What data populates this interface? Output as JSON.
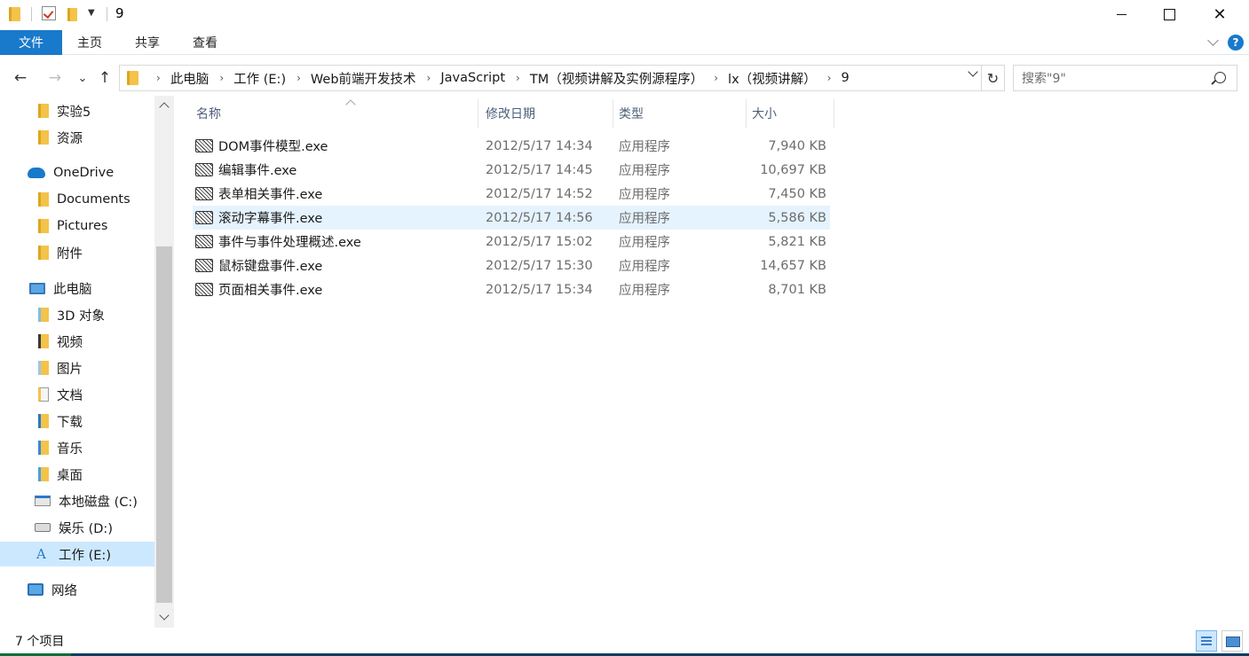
{
  "window": {
    "title": "9",
    "minimize": "",
    "maximize": "",
    "close": "✕"
  },
  "ribbon": {
    "tabs": [
      {
        "label": "文件"
      },
      {
        "label": "主页"
      },
      {
        "label": "共享"
      },
      {
        "label": "查看"
      }
    ],
    "help": "?"
  },
  "nav": {
    "back": "←",
    "forward": "→",
    "recent": "⌄",
    "up": "↑",
    "breadcrumbs": [
      "此电脑",
      "工作 (E:)",
      "Web前端开发技术",
      "JavaScript",
      "TM（视频讲解及实例源程序）",
      "lx（视频讲解）",
      "9"
    ],
    "separator": "›",
    "refresh": "↻",
    "search_placeholder": "搜索\"9\""
  },
  "sidebar": {
    "items": [
      {
        "label": "实验5",
        "icon": "folder-icon"
      },
      {
        "label": "资源",
        "icon": "folder-icon"
      },
      {
        "label": "OneDrive",
        "icon": "onedrive-icon"
      },
      {
        "label": "Documents",
        "icon": "folder-icon"
      },
      {
        "label": "Pictures",
        "icon": "folder-icon"
      },
      {
        "label": "附件",
        "icon": "folder-icon"
      },
      {
        "label": "此电脑",
        "icon": "this-pc-icon"
      },
      {
        "label": "3D 对象",
        "icon": "3d-objects-icon"
      },
      {
        "label": "视频",
        "icon": "videos-icon"
      },
      {
        "label": "图片",
        "icon": "pictures-icon"
      },
      {
        "label": "文档",
        "icon": "documents-icon"
      },
      {
        "label": "下载",
        "icon": "downloads-icon"
      },
      {
        "label": "音乐",
        "icon": "music-icon"
      },
      {
        "label": "桌面",
        "icon": "desktop-icon"
      },
      {
        "label": "本地磁盘 (C:)",
        "icon": "system-drive-icon"
      },
      {
        "label": "娱乐 (D:)",
        "icon": "drive-icon"
      },
      {
        "label": "工作 (E:)",
        "icon": "drive-a-icon",
        "selected": true
      },
      {
        "label": "网络",
        "icon": "network-icon"
      }
    ]
  },
  "files": {
    "columns": {
      "name": "名称",
      "date": "修改日期",
      "type": "类型",
      "size": "大小"
    },
    "rows": [
      {
        "name": "DOM事件模型.exe",
        "date": "2012/5/17 14:34",
        "type": "应用程序",
        "size": "7,940 KB"
      },
      {
        "name": "编辑事件.exe",
        "date": "2012/5/17 14:45",
        "type": "应用程序",
        "size": "10,697 KB"
      },
      {
        "name": "表单相关事件.exe",
        "date": "2012/5/17 14:52",
        "type": "应用程序",
        "size": "7,450 KB"
      },
      {
        "name": "滚动字幕事件.exe",
        "date": "2012/5/17 14:56",
        "type": "应用程序",
        "size": "5,586 KB",
        "hover": true
      },
      {
        "name": "事件与事件处理概述.exe",
        "date": "2012/5/17 15:02",
        "type": "应用程序",
        "size": "5,821 KB"
      },
      {
        "name": "鼠标键盘事件.exe",
        "date": "2012/5/17 15:30",
        "type": "应用程序",
        "size": "14,657 KB"
      },
      {
        "name": "页面相关事件.exe",
        "date": "2012/5/17 15:34",
        "type": "应用程序",
        "size": "8,701 KB"
      }
    ]
  },
  "status": {
    "item_count": "7 个项目"
  },
  "colors": {
    "accent": "#1979ca",
    "selection": "#cce8ff",
    "hover": "#e5f3ff"
  }
}
